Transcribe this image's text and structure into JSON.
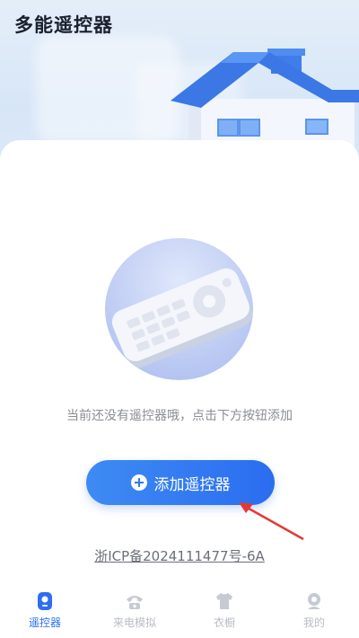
{
  "app": {
    "title": "多能遥控器"
  },
  "main": {
    "empty_hint": "当前还没有遥控器哦，点击下方按钮添加",
    "add_button_label": "添加遥控器",
    "icp_text": "浙ICP备2024111477号-6A"
  },
  "tabbar": {
    "items": [
      {
        "label": "遥控器",
        "icon": "remote-icon",
        "active": true
      },
      {
        "label": "来电模拟",
        "icon": "phone-icon",
        "active": false
      },
      {
        "label": "衣橱",
        "icon": "shirt-icon",
        "active": false
      },
      {
        "label": "我的",
        "icon": "profile-icon",
        "active": false
      }
    ]
  },
  "colors": {
    "accent": "#2d6ff0",
    "arrow": "#e53935",
    "inactive_tab": "#b8bcc4"
  }
}
